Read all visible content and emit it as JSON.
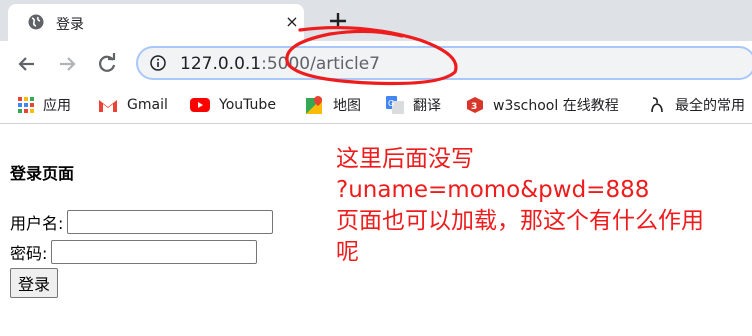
{
  "browser": {
    "tab": {
      "title": "登录",
      "close": "×",
      "new_tab": "+"
    },
    "address": {
      "host": "127.0.0.1",
      "rest": ":5000/article7"
    },
    "bookmarks": [
      {
        "label": "应用",
        "icon": "apps-grid-icon"
      },
      {
        "label": "Gmail",
        "icon": "gmail-icon"
      },
      {
        "label": "YouTube",
        "icon": "youtube-icon"
      },
      {
        "label": "地图",
        "icon": "maps-icon"
      },
      {
        "label": "翻译",
        "icon": "translate-icon"
      },
      {
        "label": "w3school 在线教程",
        "icon": "w3school-icon"
      },
      {
        "label": "最全的常用",
        "icon": "bookmark-icon"
      }
    ]
  },
  "page": {
    "title": "登录页面",
    "username_label": "用户名:",
    "password_label": "密码:",
    "submit_label": "登录"
  },
  "annotation": {
    "line1": "这里后面没写",
    "line2": "?uname=momo&pwd=888",
    "line3": "页面也可以加载，那这个有什么作用",
    "line4": "呢",
    "color": "#ee1c1c"
  }
}
